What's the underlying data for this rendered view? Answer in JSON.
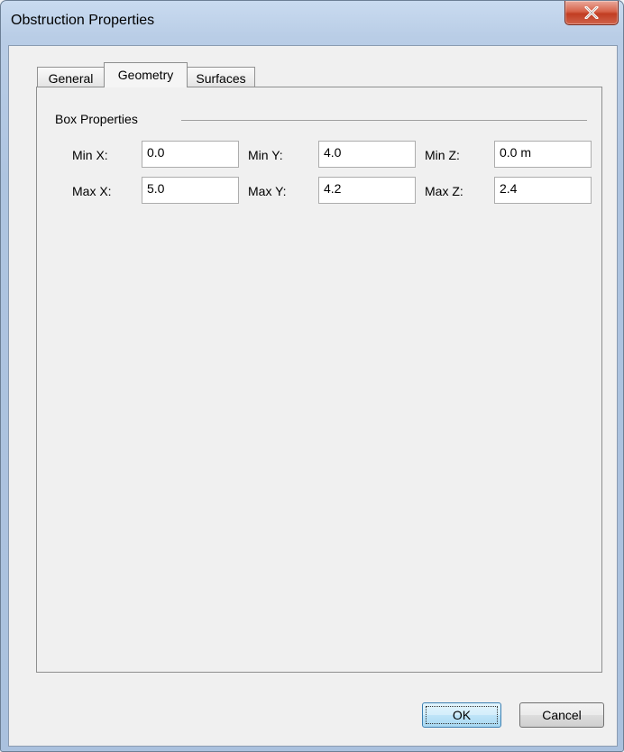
{
  "window": {
    "title": "Obstruction Properties",
    "close_icon": "close-icon"
  },
  "tabs": [
    {
      "label": "General"
    },
    {
      "label": "Geometry",
      "selected": true
    },
    {
      "label": "Surfaces"
    }
  ],
  "box_properties": {
    "title": "Box Properties",
    "fields": {
      "min_x": {
        "label": "Min X:",
        "value": "0.0"
      },
      "min_y": {
        "label": "Min Y:",
        "value": "4.0"
      },
      "min_z": {
        "label": "Min Z:",
        "value": "0.0 m"
      },
      "max_x": {
        "label": "Max X:",
        "value": "5.0"
      },
      "max_y": {
        "label": "Max Y:",
        "value": "4.2"
      },
      "max_z": {
        "label": "Max Z:",
        "value": "2.4"
      }
    }
  },
  "buttons": {
    "ok": "OK",
    "cancel": "Cancel"
  }
}
